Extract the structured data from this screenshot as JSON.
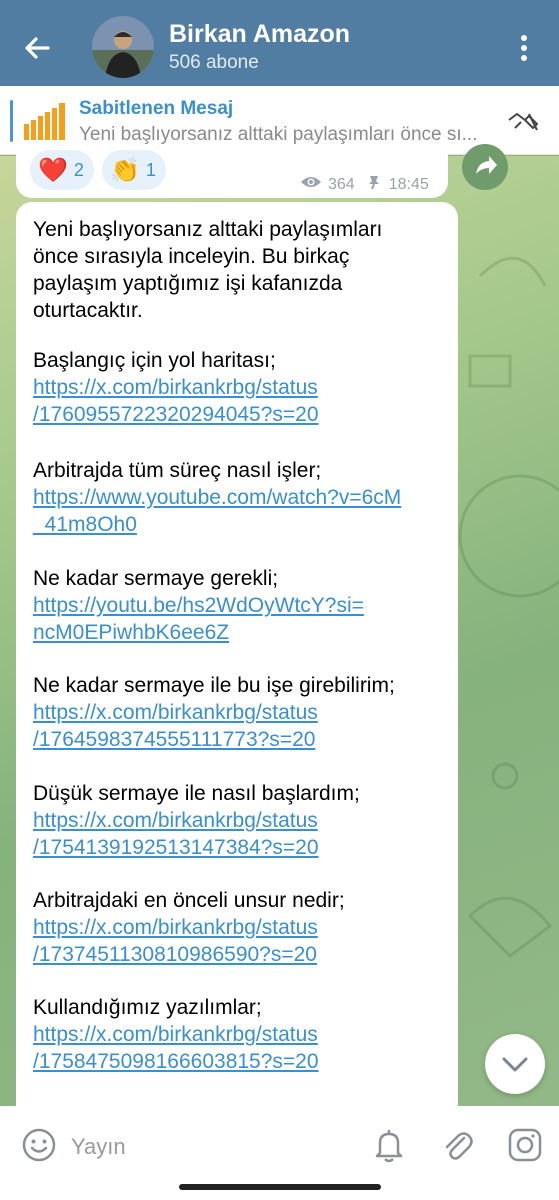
{
  "header": {
    "title": "Birkan Amazon",
    "subtitle": "506 abone"
  },
  "pinned": {
    "title": "Sabitlenen Mesaj",
    "text": "Yeni başlıyorsanız alttaki paylaşımları önce sı..."
  },
  "prev_message": {
    "reactions": [
      {
        "emoji": "❤️",
        "count": "2"
      },
      {
        "emoji": "👏",
        "count": "1"
      }
    ],
    "views": "364",
    "time": "18:45"
  },
  "message": {
    "intro": [
      "Yeni başlıyorsanız alttaki paylaşımları",
      "önce sırasıyla inceleyin. Bu birkaç",
      "paylaşım yaptığımız işi kafanızda",
      "oturtacaktır."
    ],
    "sections": [
      {
        "label": "Başlangıç için yol haritası;",
        "link": [
          "https://x.com/birkankrbg/status",
          "/1760955722320294045?s=20"
        ]
      },
      {
        "label": "Arbitrajda tüm süreç nasıl işler;",
        "link": [
          "https://www.youtube.com/watch?v=6cM",
          "_41m8Oh0"
        ]
      },
      {
        "label": "Ne kadar sermaye gerekli;",
        "link": [
          "https://youtu.be/hs2WdOyWtcY?si=",
          "ncM0EPiwhbK6ee6Z"
        ]
      },
      {
        "label": "Ne kadar sermaye ile bu işe girebilirim;",
        "link": [
          "https://x.com/birkankrbg/status",
          "/1764598374555111773?s=20"
        ]
      },
      {
        "label": "Düşük sermaye ile nasıl başlardım;",
        "link": [
          "https://x.com/birkankrbg/status",
          "/1754139192513147384?s=20"
        ]
      },
      {
        "label": "Arbitrajdaki en önceli unsur nedir;",
        "link": [
          "https://x.com/birkankrbg/status",
          "/1737451130810986590?s=20"
        ]
      },
      {
        "label": "Kullandığımız yazılımlar;",
        "link": [
          "https://x.com/birkankrbg/status",
          "/1758475098166603815?s=20"
        ]
      }
    ]
  },
  "input": {
    "placeholder": "Yayın"
  },
  "colors": {
    "header": "#517da2",
    "link": "#3a8fce",
    "accent": "#4a95d6"
  }
}
